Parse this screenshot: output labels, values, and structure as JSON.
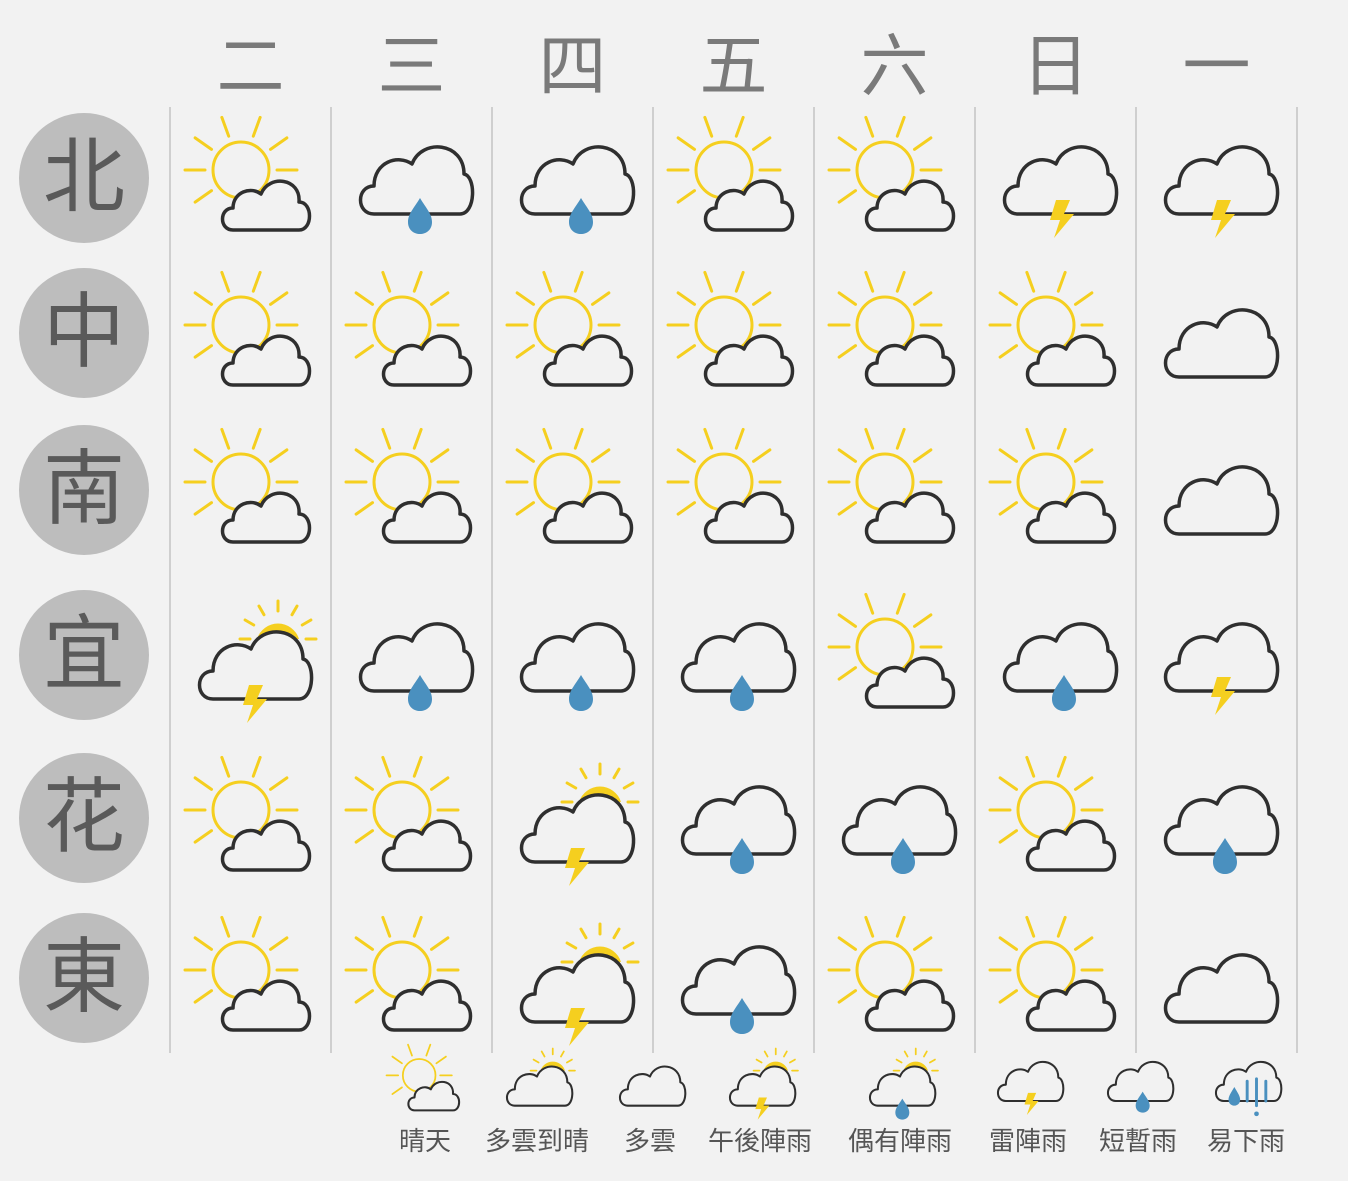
{
  "days": [
    "二",
    "三",
    "四",
    "五",
    "六",
    "日",
    "一"
  ],
  "regions": [
    "北",
    "中",
    "南",
    "宜",
    "花",
    "東"
  ],
  "forecast": [
    [
      "晴天",
      "短暫雨",
      "短暫雨",
      "晴天",
      "晴天",
      "雷陣雨",
      "雷陣雨"
    ],
    [
      "晴天",
      "晴天",
      "晴天",
      "晴天",
      "晴天",
      "晴天",
      "多雲"
    ],
    [
      "晴天",
      "晴天",
      "晴天",
      "晴天",
      "晴天",
      "晴天",
      "多雲"
    ],
    [
      "午後陣雨",
      "短暫雨",
      "短暫雨",
      "短暫雨",
      "晴天",
      "短暫雨",
      "雷陣雨"
    ],
    [
      "晴天",
      "晴天",
      "午後陣雨",
      "短暫雨",
      "短暫雨",
      "晴天",
      "短暫雨"
    ],
    [
      "晴天",
      "晴天",
      "午後陣雨",
      "短暫雨",
      "晴天",
      "晴天",
      "多雲"
    ]
  ],
  "legend": [
    {
      "label": "晴天",
      "icon": "sun-behind-cloud-icon"
    },
    {
      "label": "多雲到晴",
      "icon": "cloud-with-sun-icon"
    },
    {
      "label": "多雲",
      "icon": "cloud-icon"
    },
    {
      "label": "午後陣雨",
      "icon": "afternoon-thunder-shower-icon"
    },
    {
      "label": "偶有陣雨",
      "icon": "occasional-shower-icon"
    },
    {
      "label": "雷陣雨",
      "icon": "thunderstorm-icon"
    },
    {
      "label": "短暫雨",
      "icon": "brief-rain-icon"
    },
    {
      "label": "易下雨",
      "icon": "likely-rain-icon"
    }
  ],
  "colors": {
    "sun": "#f5cf1f",
    "cloud_outline": "#2f2f2f",
    "rain": "#4a90bf",
    "background": "#f2f2f2",
    "region_circle": "#bdbdbd",
    "region_text": "#5a5a5a",
    "day_text": "#7a7a7a",
    "divider": "#cfcfcf"
  }
}
